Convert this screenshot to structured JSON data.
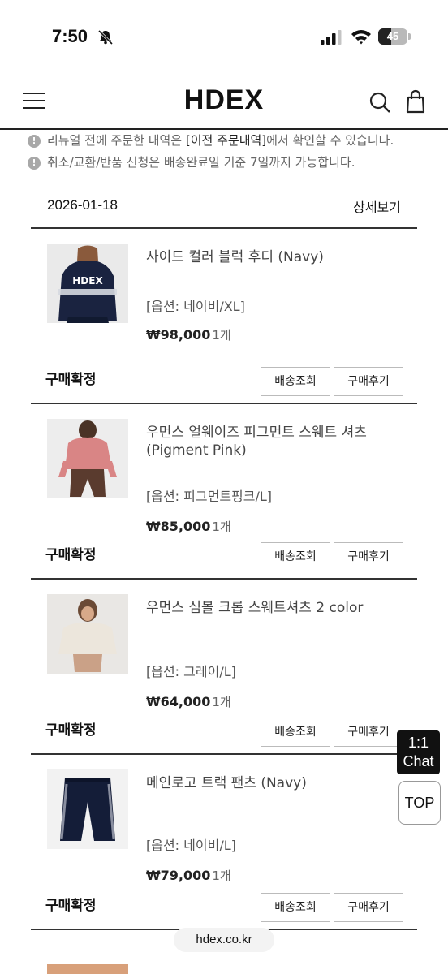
{
  "status_bar": {
    "time": "7:50",
    "battery": "45",
    "battery_level": 0.45
  },
  "header": {
    "logo": "HDEX"
  },
  "notices": [
    {
      "icon": "!",
      "pre": "리뉴얼 전에 주문한 내역은 ",
      "highlight": "[이전 주문내역]",
      "post": "에서 확인할 수 있습니다."
    },
    {
      "icon": "!",
      "text": "취소/교환/반품 신청은 배송완료일 기준 7일까지 가능합니다."
    }
  ],
  "order": {
    "date": "2026-01-18",
    "detail_label": "상세보기"
  },
  "items": [
    {
      "name": "사이드 컬러 블럭 후디 (Navy)",
      "option": "[옵션: 네이비/XL]",
      "price": "₩98,000",
      "qty": "1개",
      "status": "구매확정",
      "track_label": "배송조회",
      "review_label": "구매후기"
    },
    {
      "name": "우먼스 얼웨이즈 피그먼트 스웨트 셔츠 (Pigment Pink)",
      "option": "[옵션: 피그먼트핑크/L]",
      "price": "₩85,000",
      "qty": "1개",
      "status": "구매확정",
      "track_label": "배송조회",
      "review_label": "구매후기"
    },
    {
      "name": "우먼스 심볼 크롭 스웨트셔츠 2 color",
      "option": "[옵션: 그레이/L]",
      "price": "₩64,000",
      "qty": "1개",
      "status": "구매확정",
      "track_label": "배송조회",
      "review_label": "구매후기"
    },
    {
      "name": "메인로고 트랙 팬츠 (Navy)",
      "option": "[옵션: 네이비/L]",
      "price": "₩79,000",
      "qty": "1개",
      "status": "구매확정",
      "track_label": "배송조회",
      "review_label": "구매후기"
    }
  ],
  "floating": {
    "chat_line1": "1:1",
    "chat_line2": "Chat",
    "top_label": "TOP"
  },
  "browser": {
    "url": "hdex.co.kr"
  },
  "colors": {
    "accent": "#111111",
    "border": "#333333",
    "muted": "#666666"
  }
}
